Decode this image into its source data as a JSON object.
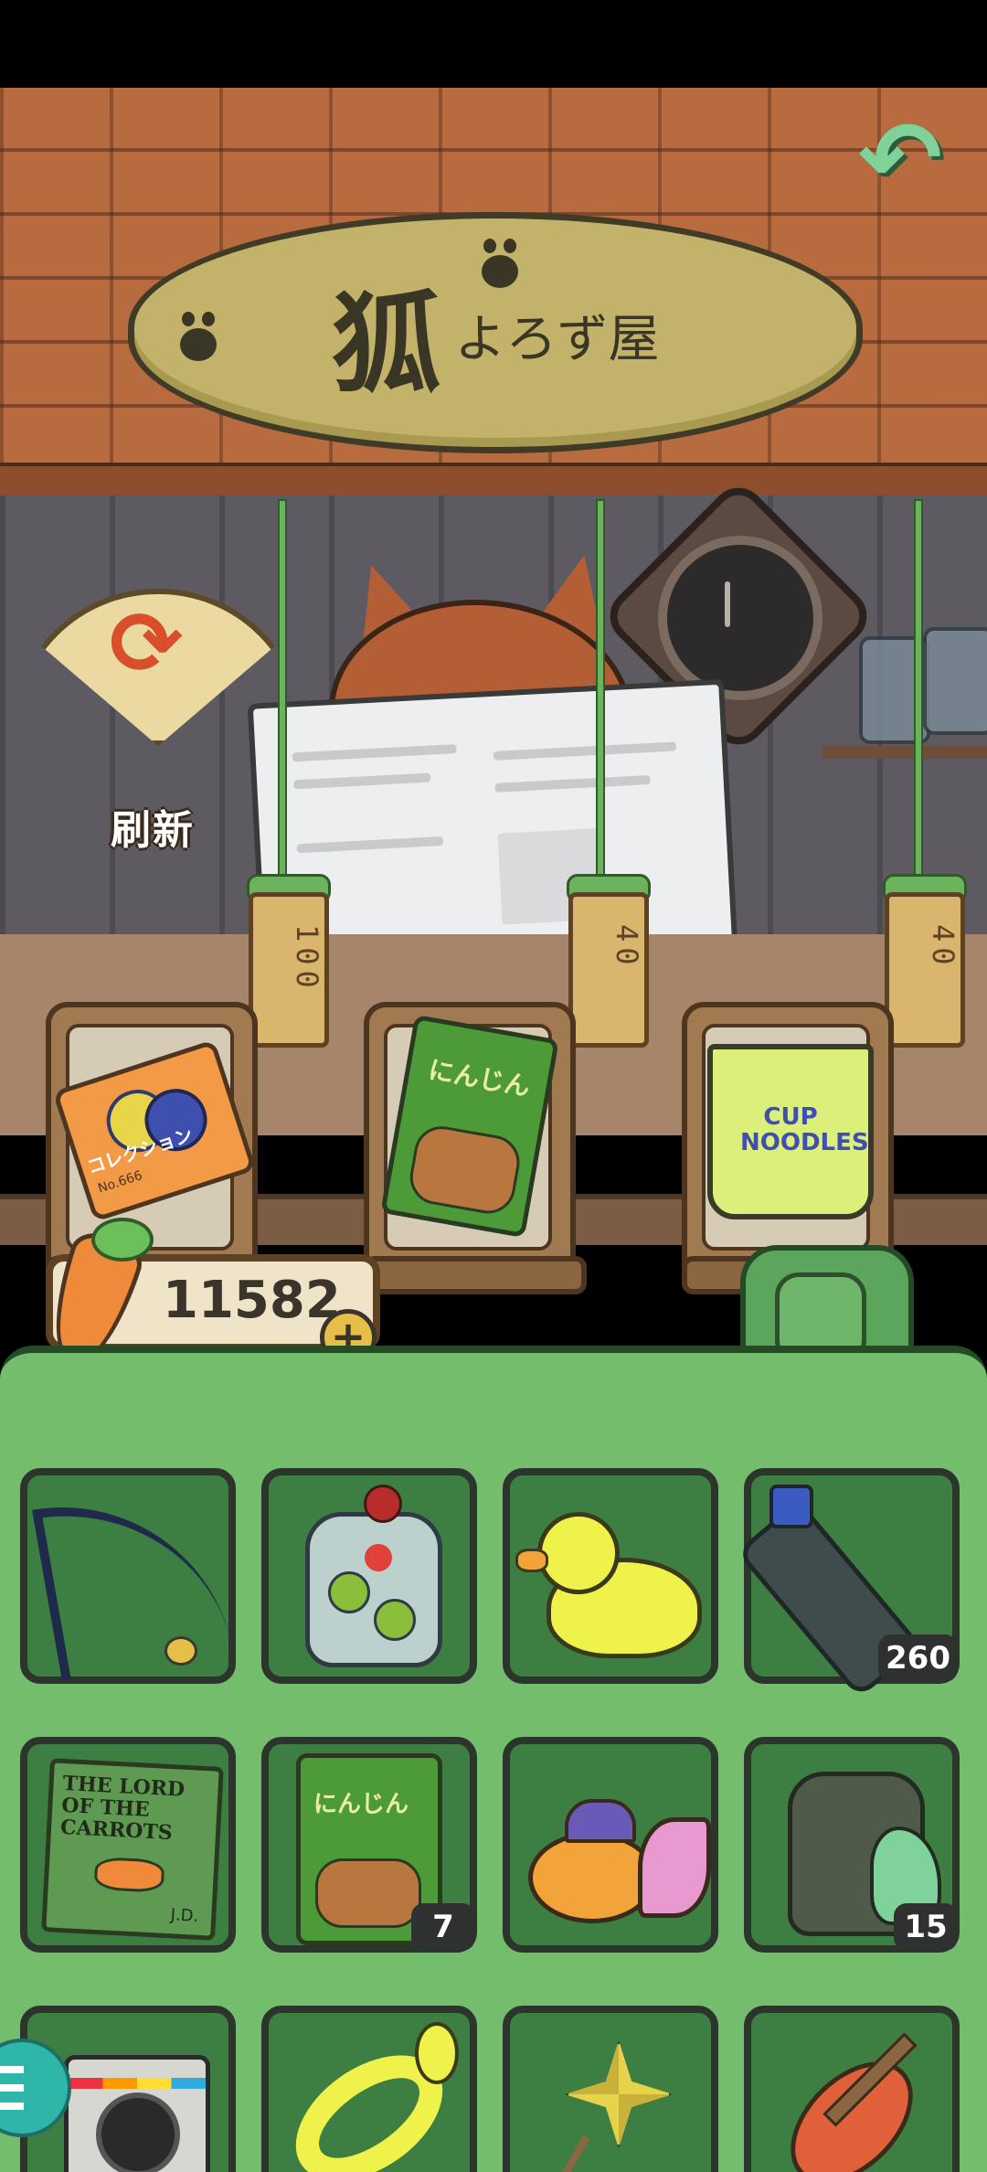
{
  "shop": {
    "sign_big": "狐",
    "sign_small": "よろず屋",
    "refresh_label": "刷新",
    "back_icon": "back-arrow-icon",
    "items": [
      {
        "name": "collection-ticket",
        "price": "100",
        "art_text": "コレクション",
        "art_sub": "No.666"
      },
      {
        "name": "carrot-snack-bag",
        "price": "40",
        "art_text": "にんじん"
      },
      {
        "name": "cup-noodles",
        "price": "40",
        "art_text": "CUP NOODLES"
      }
    ]
  },
  "currency": {
    "value": "11582",
    "plus_label": "+"
  },
  "inventory": {
    "slots": [
      {
        "item": "fishing-rod",
        "count": ""
      },
      {
        "item": "fruit-jelly-jar",
        "count": ""
      },
      {
        "item": "rubber-duck",
        "count": ""
      },
      {
        "item": "plastic-bottle",
        "count": "260"
      },
      {
        "item": "book-lord-of-the-carrots",
        "count": "",
        "title": "THE LORD OF THE CARROTS",
        "author": "J.D."
      },
      {
        "item": "carrot-snack-bag",
        "count": "7"
      },
      {
        "item": "goldfish-lantern",
        "count": ""
      },
      {
        "item": "backpack",
        "count": "15"
      },
      {
        "item": "instant-camera",
        "count": ""
      },
      {
        "item": "swim-ring",
        "count": ""
      },
      {
        "item": "pinwheel",
        "count": ""
      },
      {
        "item": "ukulele",
        "count": ""
      }
    ]
  },
  "colors": {
    "panel": "#73bd6c",
    "slot": "#3d7f43",
    "roof": "#b96b40",
    "sign": "#c2b26a"
  }
}
